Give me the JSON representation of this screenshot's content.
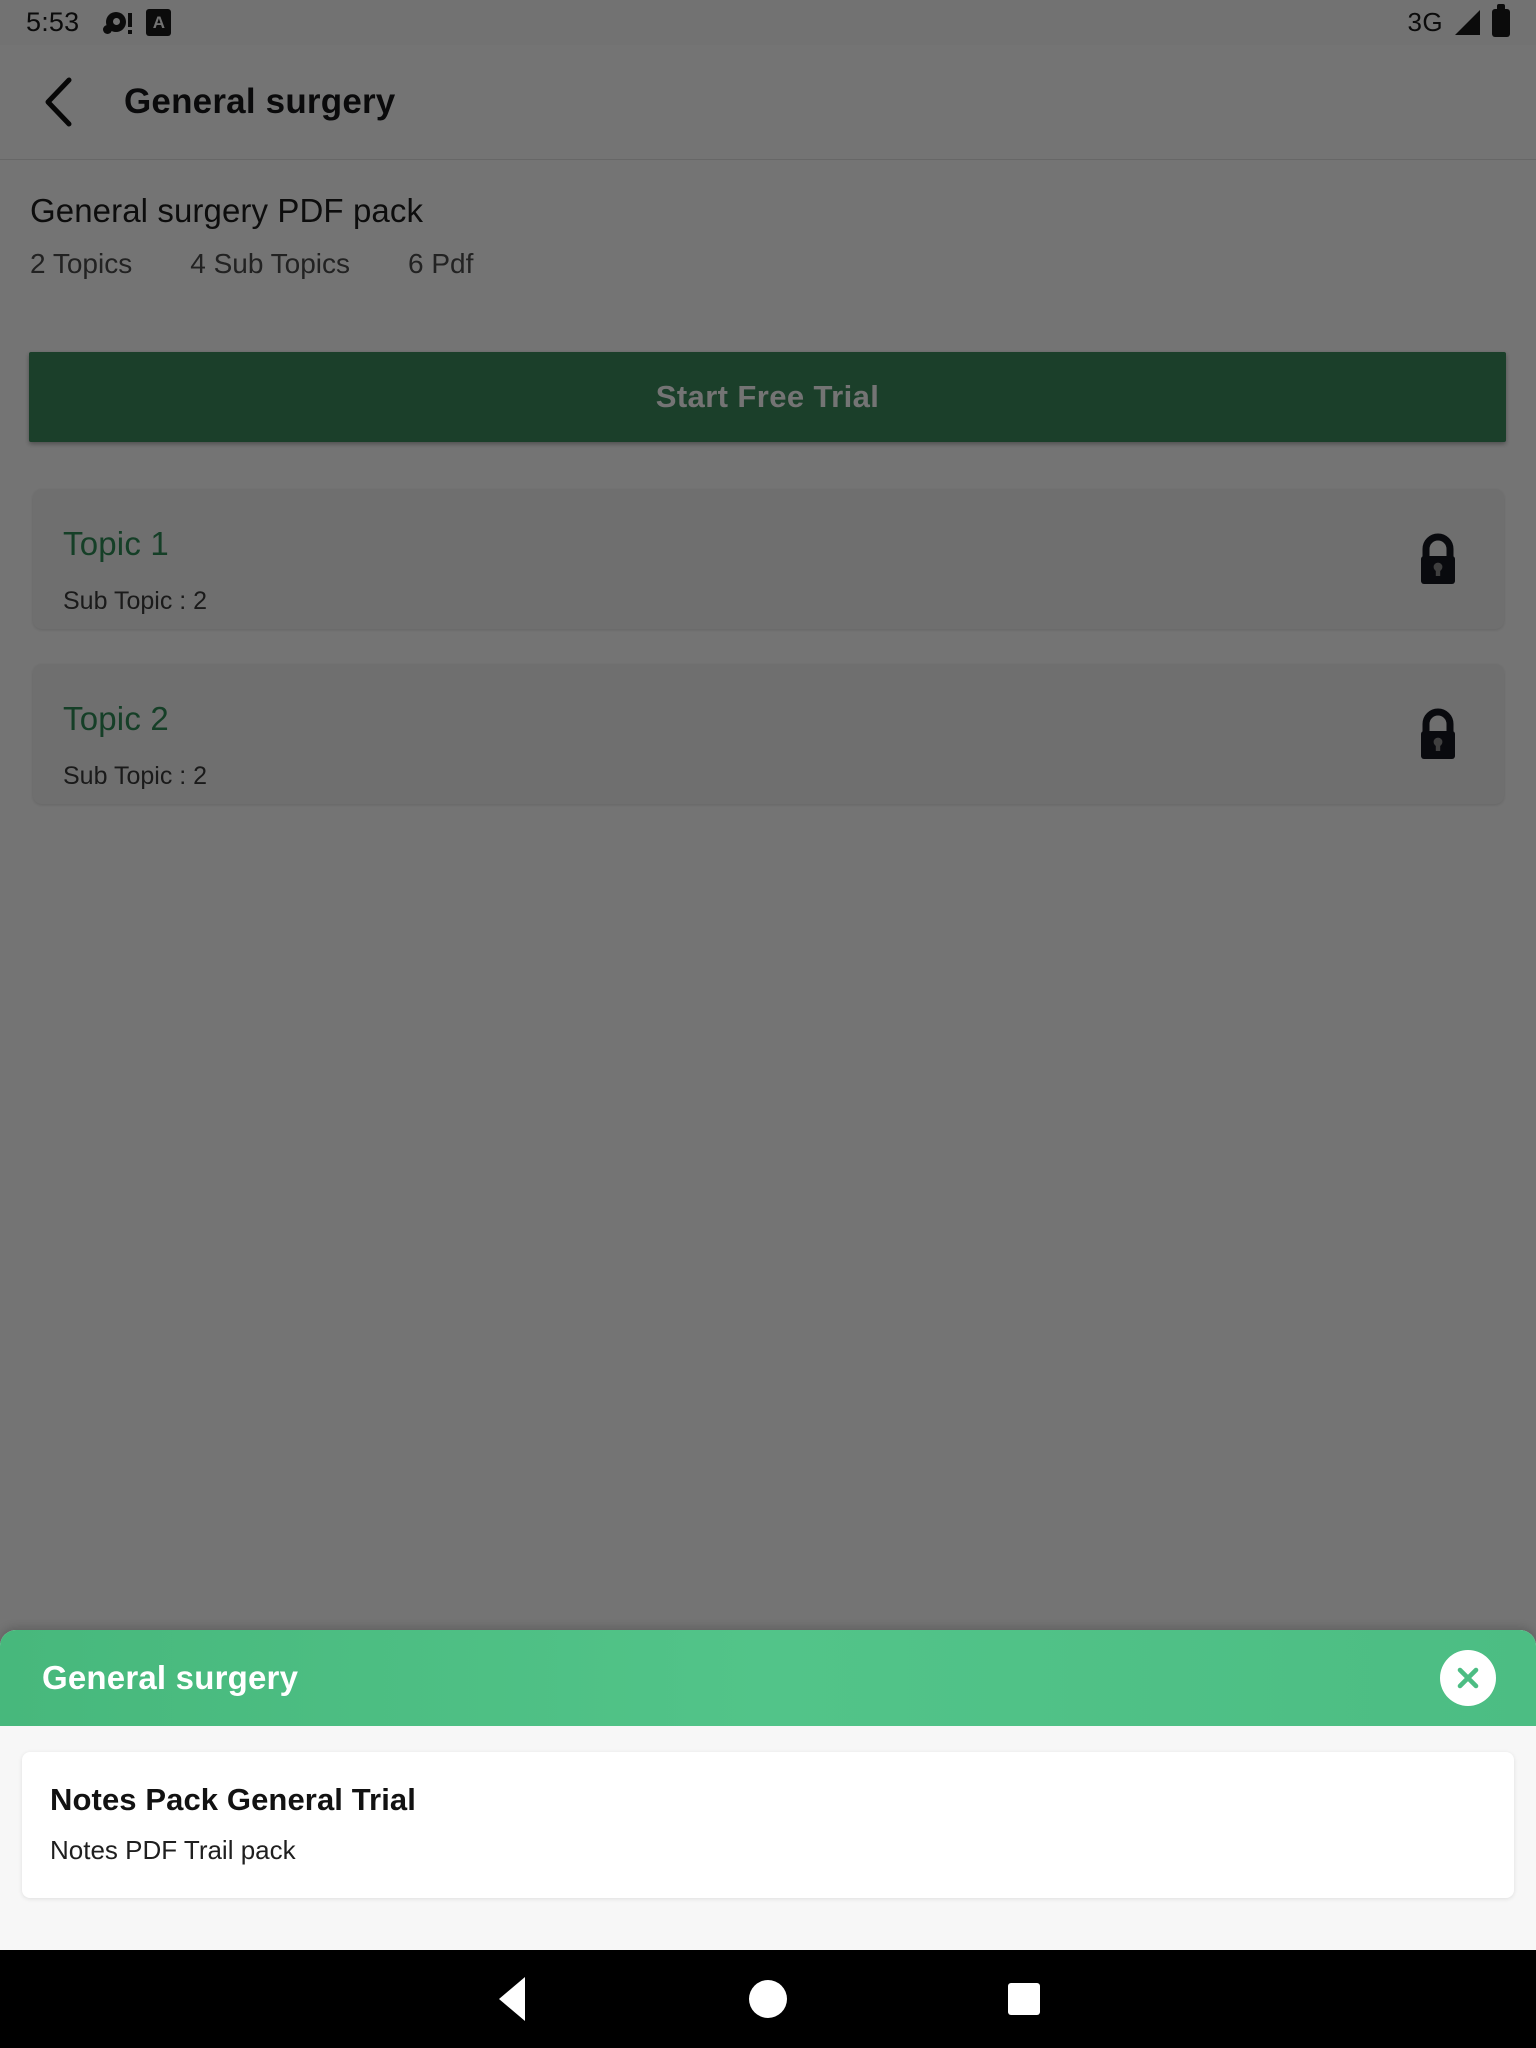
{
  "status_bar": {
    "time": "5:53",
    "left_icons": [
      "notification-alert-icon",
      "app-a-icon"
    ],
    "network": "3G",
    "right_icons": [
      "signal-icon",
      "battery-icon"
    ]
  },
  "app_bar": {
    "back_icon": "chevron-left-icon",
    "title": "General surgery"
  },
  "pack": {
    "title": "General surgery PDF pack",
    "meta": [
      "2 Topics",
      "4 Sub Topics",
      "6 Pdf"
    ]
  },
  "cta": {
    "label": "Start Free Trial"
  },
  "topics": [
    {
      "name": "Topic 1",
      "sub": "Sub Topic : 2",
      "lock_icon": "lock-closed-icon"
    },
    {
      "name": "Topic 2",
      "sub": "Sub Topic : 2",
      "lock_icon": "lock-closed-icon"
    }
  ],
  "bottom_sheet": {
    "title": "General surgery",
    "close_icon": "close-x-icon",
    "items": [
      {
        "title": "Notes Pack General Trial",
        "subtitle": "Notes PDF Trail pack"
      }
    ]
  },
  "nav_bar": {
    "back": "triangle-back-icon",
    "home": "circle-home-icon",
    "recents": "square-recents-icon"
  },
  "colors": {
    "brand_green": "#4cbd83",
    "cta_green": "#3c8c5d",
    "topic_green": "#2e8b57",
    "scrim": "rgba(0,0,0,0.545)",
    "sheet_bg": "#f7f7f7"
  }
}
